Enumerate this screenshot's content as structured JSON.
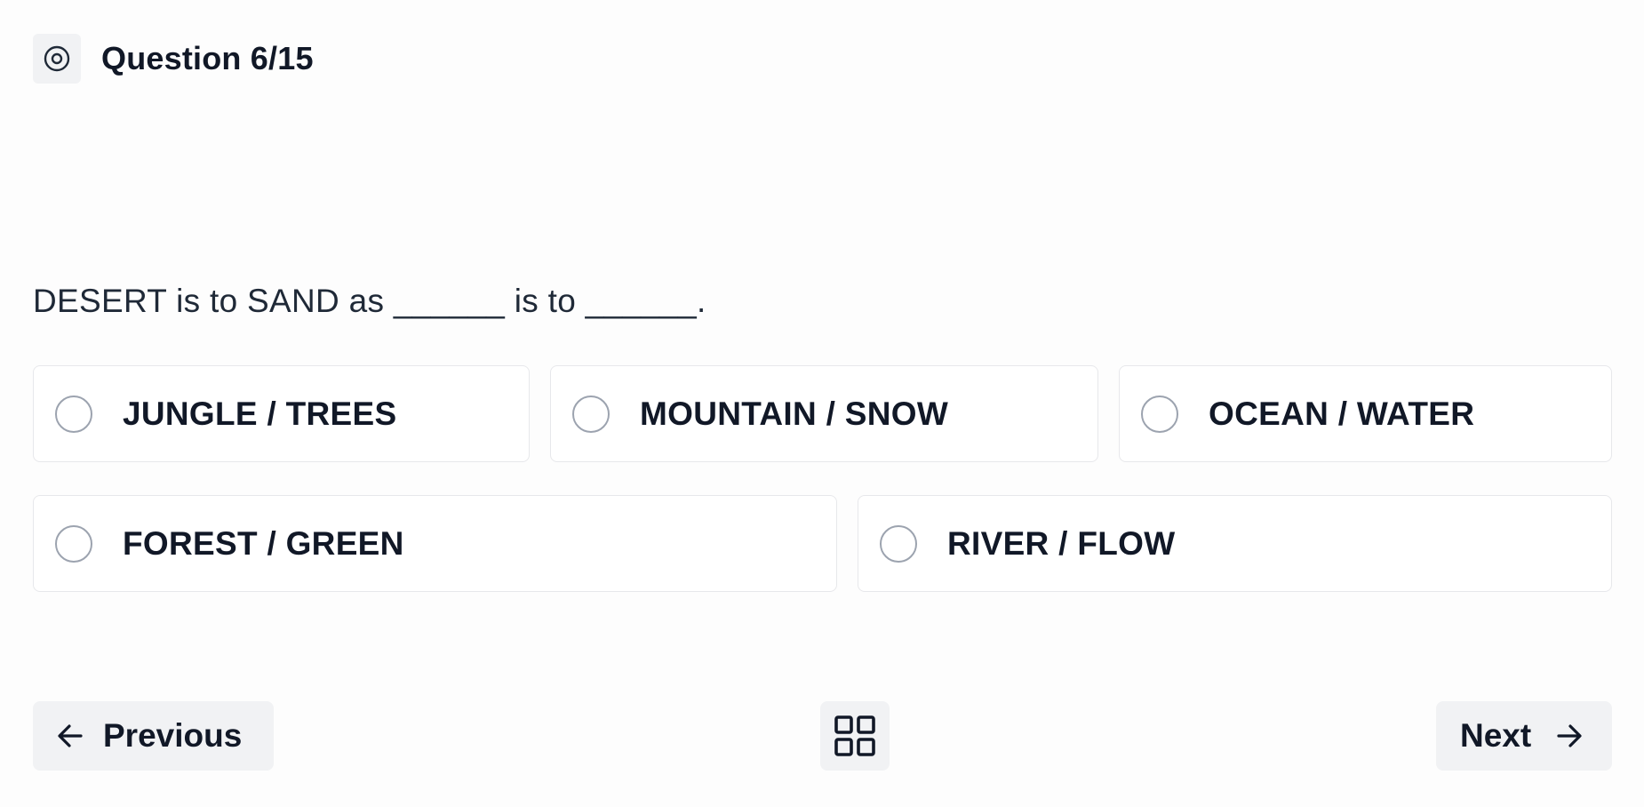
{
  "header": {
    "icon": "target-icon",
    "title": "Question 6/15"
  },
  "question": {
    "text": "DESERT is to SAND as ______ is to ______."
  },
  "options": [
    {
      "label": "JUNGLE / TREES",
      "selected": false
    },
    {
      "label": "MOUNTAIN / SNOW",
      "selected": false
    },
    {
      "label": "OCEAN / WATER",
      "selected": false
    },
    {
      "label": "FOREST / GREEN",
      "selected": false
    },
    {
      "label": "RIVER / FLOW",
      "selected": false
    }
  ],
  "footer": {
    "previous_label": "Previous",
    "previous_icon": "arrow-left-icon",
    "grid_icon": "grid-icon",
    "next_label": "Next",
    "next_icon": "arrow-right-icon"
  },
  "colors": {
    "background": "#fdfdfd",
    "text": "#111827",
    "button_bg": "#f1f2f4",
    "border": "#e7e8eb",
    "radio_border": "#9ca3af"
  }
}
